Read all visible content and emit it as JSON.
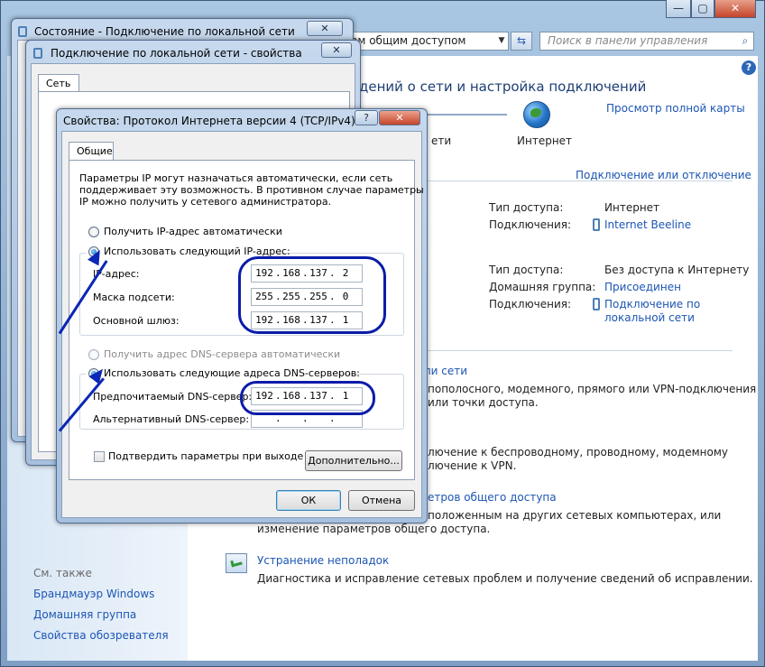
{
  "main": {
    "address": "ом общим доступом",
    "search_placeholder": "Поиск в панели управления",
    "heading": "дений о сети и настройка подключений",
    "view_full_map": "Просмотр полной карты",
    "nodes": {
      "left_label": "ети",
      "internet_label": "Интернет"
    },
    "connect_disconnect": "Подключение или отключение",
    "net1": {
      "access_type_label": "Тип доступа:",
      "access_type_value": "Интернет",
      "connections_label": "Подключения:",
      "connections_value": "Internet Beeline"
    },
    "net2": {
      "access_type_label": "Тип доступа:",
      "access_type_value": "Без доступа к Интернету",
      "homegroup_label": "Домашняя группа:",
      "homegroup_value": "Присоединен",
      "connections_label": "Подключения:",
      "connections_value_line1": "Подключение по",
      "connections_value_line2": "локальной сети"
    },
    "tasks": {
      "t1_title": "ли сети",
      "t1_desc_line1": "пополосного, модемного, прямого или VPN-подключения",
      "t1_desc_line2": "или точки доступа.",
      "t2_desc_line1": "лючение к беспроводному, проводному, модемному",
      "t2_desc_line2": "лючение к VPN.",
      "t3_title": "етров общего доступа",
      "t3_desc_line1": "положенным на других сетевых компьютерах, или",
      "t3_desc_line2": "изменение параметров общего доступа.",
      "troubleshoot_title": "Устранение неполадок",
      "troubleshoot_desc": "Диагностика и исправление сетевых проблем и получение сведений об исправлении."
    },
    "see_also": {
      "heading": "См. также",
      "items": [
        "Брандмауэр Windows",
        "Домашняя группа",
        "Свойства обозревателя"
      ]
    }
  },
  "dlg_status": {
    "title": "Состояние - Подключение по локальной сети"
  },
  "dlg_props": {
    "title": "Подключение по локальной сети - свойства",
    "tab": "Сеть"
  },
  "dlg_ipv4": {
    "title": "Свойства: Протокол Интернета версии 4 (TCP/IPv4)",
    "help_label": "?",
    "close_label": "X",
    "tab": "Общие",
    "intro_line1": "Параметры IP могут назначаться автоматически, если сеть",
    "intro_line2": "поддерживает эту возможность. В противном случае параметры",
    "intro_line3": "IP можно получить у сетевого администратора.",
    "radio_auto_ip": "Получить IP-адрес автоматически",
    "radio_manual_ip": "Использовать следующий IP-адрес:",
    "ip_label": "IP-адрес:",
    "mask_label": "Маска подсети:",
    "gateway_label": "Основной шлюз:",
    "ip": [
      "192",
      "168",
      "137",
      "2"
    ],
    "mask": [
      "255",
      "255",
      "255",
      "0"
    ],
    "gateway": [
      "192",
      "168",
      "137",
      "1"
    ],
    "radio_auto_dns": "Получить адрес DNS-сервера автоматически",
    "radio_manual_dns": "Использовать следующие адреса DNS-серверов:",
    "pref_dns_label": "Предпочитаемый DNS-сервер:",
    "alt_dns_label": "Альтернативный DNS-сервер:",
    "pref_dns": [
      "192",
      "168",
      "137",
      "1"
    ],
    "alt_dns": [
      "",
      "",
      "",
      ""
    ],
    "validate_label": "Подтвердить параметры при выходе",
    "advanced_button": "Дополнительно...",
    "ok_button": "ОК",
    "cancel_button": "Отмена"
  },
  "window_buttons": {
    "minimize": "—",
    "maximize": "▢",
    "close": "✕",
    "dlg_close": "✕"
  },
  "colors": {
    "link": "#1c56b4",
    "annotation": "#0b1ca8",
    "accent": "#2c67b7"
  }
}
